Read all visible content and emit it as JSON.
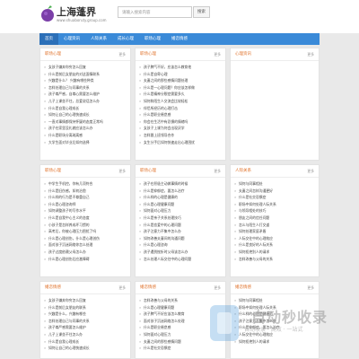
{
  "header": {
    "site_name": "上海蓬界",
    "site_url": "www.shuaboruty.group.com",
    "search_placeholder": "请输入搜索内容",
    "search_button": "搜索"
  },
  "nav": [
    "首页",
    "心理资讯",
    "人际关系",
    "成长心理",
    "职场心理",
    "婚恋情感"
  ],
  "more_label": "更多",
  "cards": [
    {
      "title": "职场心理",
      "items": [
        "女孩子嫌弃你穷怎么回复",
        "什么是前后女朋友的对这面情联系",
        "兴趣是什么？ 兴趣有哪些种类",
        "怎样处理自己与同事的关系",
        "孩子尊严感，自尊心需要怎么维护",
        "儿子上课坐不住，总爱说话怎么办",
        "什么是自我心理成长",
        "如何让自己的心理快速成长",
        "一直对事情都保持怀疑的态度正常吗",
        "孩子在家里没礼貌应该怎么办",
        "什么是职场分离疏离感",
        "大学生面对毕业后如何选择"
      ]
    },
    {
      "title": "职场心理",
      "items": [
        "孩子脾气不好，应该怎么教育他",
        "什么是自卑心理",
        "夫妻之间的那些感情问题处理",
        "什么是一心理问题？你应该怎样做",
        "什么是精神分裂症需要多久",
        "如何和陌生人交流会比较轻松",
        "伴侣所经历的心理打击",
        "什么是职业倦怠感",
        "你会在生活中有恐惧的情绪吗",
        "女孩子上课为何会出现厌学",
        "怎样跟上班领导合作",
        "女生分手后如何快速走出心理困扰"
      ]
    },
    {
      "title": "心理资讯",
      "items": []
    },
    {
      "title": "职场心理",
      "items": [
        "中学生手机控，你有几项符合",
        "什么是旧伤感，如何治愈",
        "什么样的行为是不尊重自己",
        "什么是心理咨询师",
        "如何调整孩子的写作水平",
        "什么是自我中心主义的态度",
        "小孩子是怎样养成坏习惯的",
        "高考后，你被心理压力困扰了吗",
        "什么是心理创伤，什么是心理创伤",
        "面对孩子沉迷网络你怎么处理",
        "孩子过度依赖父母怎么办",
        "什么是心理创伤后应激障碍"
      ]
    },
    {
      "title": "职场心理",
      "items": [
        "孩子在积极主动做事情的时候",
        "什么是抑郁症，要怎么治疗",
        "什么样的心理是健康的",
        "什么是心理健康问题",
        "如何面对心理压力",
        "什么是亲子关系处理技巧",
        "什么是恋爱中的心理问题",
        "孩子注意力不集中怎么办",
        "如何改善夫妻间的沟通问题",
        "什么是心理咨询",
        "孩子遇到挫折时父母该怎么办",
        "怎么处理人际交往中的心理问题"
      ]
    },
    {
      "title": "人际关系",
      "items": [
        "如何与同事相处",
        "夫妻之间怎样沟通更好",
        "什么是社交恐惧症",
        "职场中如何处理人际关系",
        "与领导相处的技巧",
        "朋友之间的信任问题",
        "怎么与陌生人打交道",
        "如何处理家庭矛盾",
        "人际交往中的心理效应",
        "什么是良好的人际关系",
        "如何拒绝别人的请求",
        "怎样改善与父母的关系"
      ]
    },
    {
      "title": "婚恋情感",
      "items": [
        "女孩子嫌弃你穷怎么回复",
        "什么是前后女朋友的联系",
        "兴趣是什么，兴趣有哪些",
        "怎样处理自己与同事的关系",
        "孩子尊严感需要怎么维护",
        "儿子上课坐不住怎么办",
        "什么是自我心理成长",
        "如何让自己的心理快速成长"
      ]
    },
    {
      "title": "婚恋情感",
      "items": [
        "怎样改善与父母的关系",
        "什么是心理健康问题",
        "孩子脾气不好应该怎么教育",
        "面对孩子沉迷网络怎么处理",
        "什么是职业倦怠感",
        "如何面对心理压力",
        "夫妻之间的那些感情问题",
        "什么是社交恐惧症"
      ]
    },
    {
      "title": "婚恋情感",
      "items": [
        "如何与同事相处",
        "职场中如何处理人际关系",
        "什么样的心理是健康的",
        "孩子注意力不集中怎么办",
        "什么是抑郁症，要怎么治疗",
        "人际交往中的心理效应",
        "如何拒绝别人的请求"
      ]
    }
  ],
  "watermark": {
    "text": "自动秒收录",
    "sub": "自动收录 · 高效 · 一站式"
  },
  "colors": {
    "nav": "#3a8ad8",
    "nav_active": "#2b6fb8",
    "card_title": "#e0732c",
    "background": "#e9e9e9"
  }
}
